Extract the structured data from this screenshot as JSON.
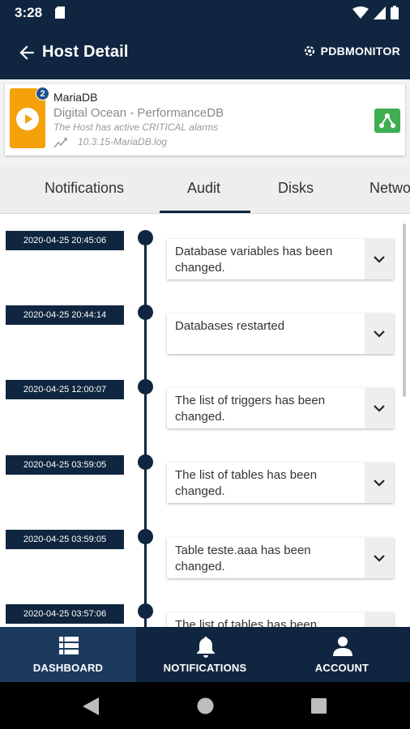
{
  "status_bar": {
    "time": "3:28"
  },
  "app_bar": {
    "title": "Host Detail",
    "brand": "PDBMONITOR"
  },
  "host": {
    "badge_count": "2",
    "name": "MariaDB",
    "provider": "Digital Ocean - PerformanceDB",
    "alarm_text": "The Host has active CRITICAL alarms",
    "log_text": "10.3.15-MariaDB.log",
    "play_color": "#f5a10a",
    "share_color": "#3fae53"
  },
  "tabs": [
    {
      "label": "Notifications"
    },
    {
      "label": "Audit",
      "selected": true
    },
    {
      "label": "Disks"
    },
    {
      "label": "Netwo"
    }
  ],
  "timeline": [
    {
      "date": "2020-04-25 20:45:06",
      "text": "Database variables has been changed."
    },
    {
      "date": "2020-04-25 20:44:14",
      "text": "Databases restarted"
    },
    {
      "date": "2020-04-25 12:00:07",
      "text": "The list of triggers has been changed."
    },
    {
      "date": "2020-04-25 03:59:05",
      "text": "The list of tables has been changed."
    },
    {
      "date": "2020-04-25 03:59:05",
      "text": "Table teste.aaa has been changed."
    },
    {
      "date": "2020-04-25 03:57:06",
      "text": "The list of tables has been changed."
    }
  ],
  "bottom_nav": [
    {
      "label": "DASHBOARD",
      "icon": "dashboard-icon",
      "active": true
    },
    {
      "label": "NOTIFICATIONS",
      "icon": "bell-icon"
    },
    {
      "label": "ACCOUNT",
      "icon": "person-icon"
    }
  ],
  "colors": {
    "primary": "#102640",
    "tab_background": "#eeeeee",
    "nav_active": "#1b3a5e"
  }
}
